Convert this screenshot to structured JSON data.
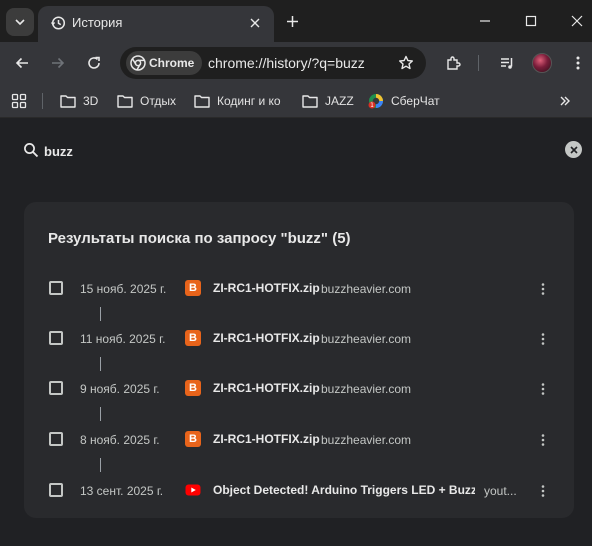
{
  "tab": {
    "title": "История",
    "favicon": "history-icon"
  },
  "toolbar": {
    "chip_label": "Chrome",
    "url": "chrome://history/?q=buzz"
  },
  "bookmarks": [
    {
      "label": "3D",
      "icon": "folder-icon"
    },
    {
      "label": "Отдых",
      "icon": "folder-icon"
    },
    {
      "label": "Кодинг и ко",
      "icon": "folder-icon"
    },
    {
      "label": "JAZZ",
      "icon": "folder-icon"
    },
    {
      "label": "СберЧат",
      "icon": "sberchat-icon"
    }
  ],
  "search": {
    "value": "buzz"
  },
  "results": {
    "title": "Результаты поиска по запросу \"buzz\" (5)",
    "items": [
      {
        "date": "15 нояб. 2025 г.",
        "favicon": "buzzheavier-icon",
        "favicon_letter": "B",
        "title": "ZI-RC1-HOTFIX.zip",
        "domain": "buzzheavier.com"
      },
      {
        "date": "11 нояб. 2025 г.",
        "favicon": "buzzheavier-icon",
        "favicon_letter": "B",
        "title": "ZI-RC1-HOTFIX.zip",
        "domain": "buzzheavier.com"
      },
      {
        "date": "9 нояб. 2025 г.",
        "favicon": "buzzheavier-icon",
        "favicon_letter": "B",
        "title": "ZI-RC1-HOTFIX.zip",
        "domain": "buzzheavier.com"
      },
      {
        "date": "8 нояб. 2025 г.",
        "favicon": "buzzheavier-icon",
        "favicon_letter": "B",
        "title": "ZI-RC1-HOTFIX.zip",
        "domain": "buzzheavier.com"
      },
      {
        "date": "13 сент. 2025 г.",
        "favicon": "youtube-icon",
        "favicon_letter": "",
        "title": "Object Detected! Arduino Triggers LED + Buzz...",
        "domain": "yout..."
      }
    ]
  },
  "colors": {
    "accent_orange": "#e8641b",
    "youtube_red": "#ff0000",
    "background": "#202124",
    "card": "#292a2d"
  }
}
